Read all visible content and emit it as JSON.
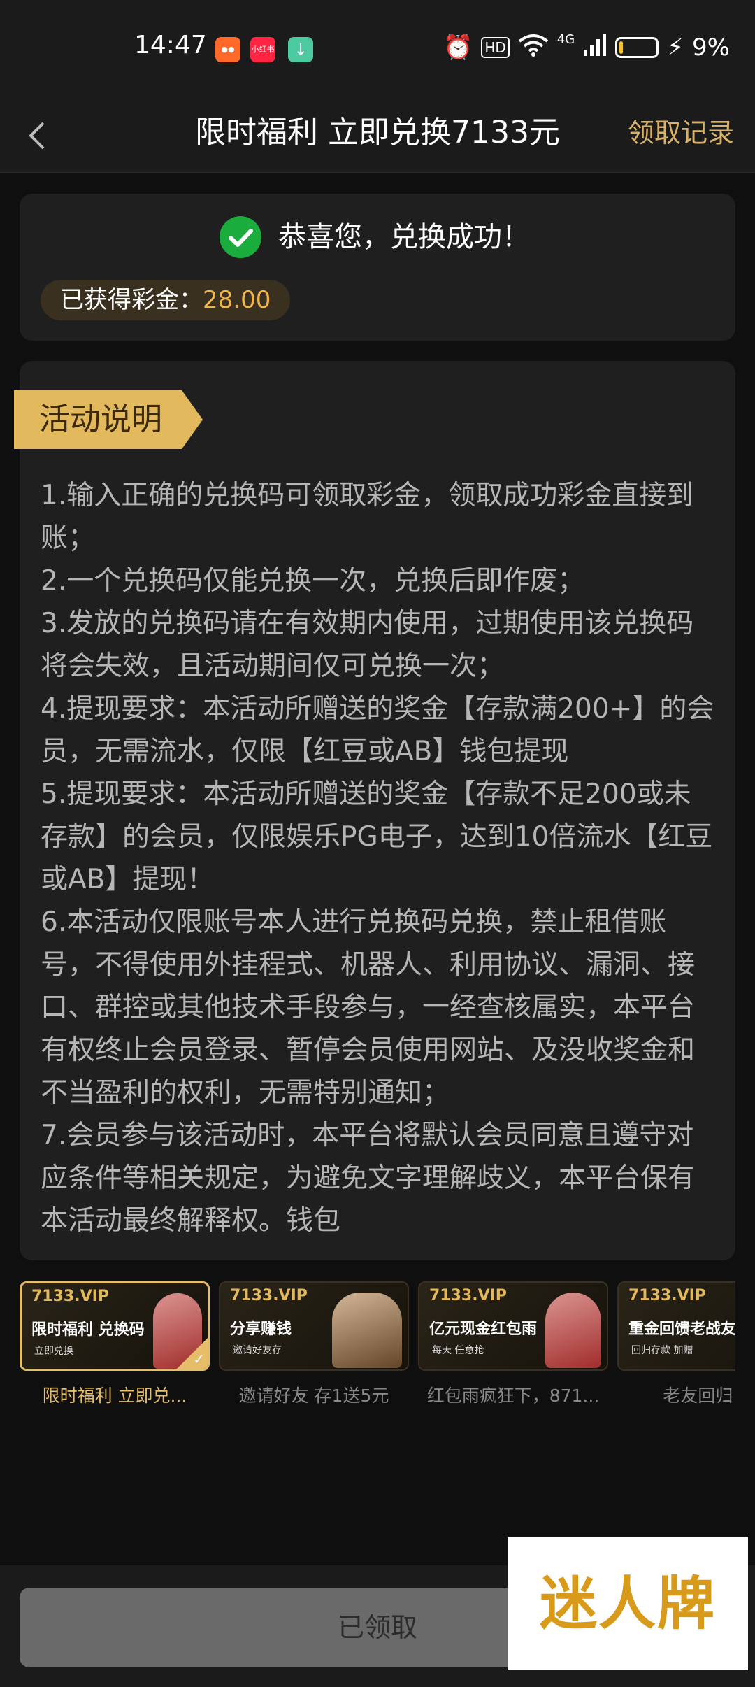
{
  "status_bar": {
    "time": "14:47",
    "app_icons": [
      "kuaishou-icon",
      "xiaohongshu-icon",
      "download-icon"
    ],
    "xiaohongshu_label": "小红书",
    "network": "4G",
    "hd_label": "HD",
    "battery": "9%",
    "battery_level": 0.09
  },
  "header": {
    "title": "限时福利 立即兑换7133元",
    "right_link": "领取记录"
  },
  "success": {
    "message": "恭喜您，兑换成功！",
    "prize_label": "已获得彩金：",
    "prize_value": "28.00"
  },
  "rules": {
    "badge": "活动说明",
    "items": [
      "1.输入正确的兑换码可领取彩金，领取成功彩金直接到账；",
      "2.一个兑换码仅能兑换一次，兑换后即作废；",
      "3.发放的兑换码请在有效期内使用，过期使用该兑换码将会失效，且活动期间仅可兑换一次；",
      "4.提现要求：本活动所赠送的奖金【存款满200+】的会员，无需流水，仅限【红豆或AB】钱包提现",
      "5.提现要求：本活动所赠送的奖金【存款不足200或未存款】的会员，仅限娱乐PG电子，达到10倍流水【红豆或AB】提现！",
      "6.本活动仅限账号本人进行兑换码兑换，禁止租借账号，不得使用外挂程式、机器人、利用协议、漏洞、接口、群控或其他技术手段参与，一经查核属实，本平台有权终止会员登录、暂停会员使用网站、及没收奖金和不当盈利的权利，无需特别通知；",
      "7.会员参与该活动时，本平台将默认会员同意且遵守对应条件等相关规定，为避免文字理解歧义，本平台保有本活动最终解释权。钱包"
    ]
  },
  "carousel": [
    {
      "logo": "7133.VIP",
      "headline": "限时福利 兑换码",
      "sub": "立即兑换",
      "caption": "限时福利 立即兑...",
      "active": true
    },
    {
      "logo": "7133.VIP",
      "headline": "分享赚钱",
      "sub": "邀请好友存",
      "caption": "邀请好友 存1送5元",
      "active": false
    },
    {
      "logo": "7133.VIP",
      "headline": "亿元现金红包雨",
      "sub": "每天 任意抢",
      "caption": "红包雨疯狂下，871...",
      "active": false
    },
    {
      "logo": "7133.VIP",
      "headline": "重金回馈老战友",
      "sub": "回归存款 加赠",
      "caption": "老友回归 第:",
      "active": false
    }
  ],
  "bottom": {
    "button": "已领取"
  },
  "watermark": "迷人牌"
}
